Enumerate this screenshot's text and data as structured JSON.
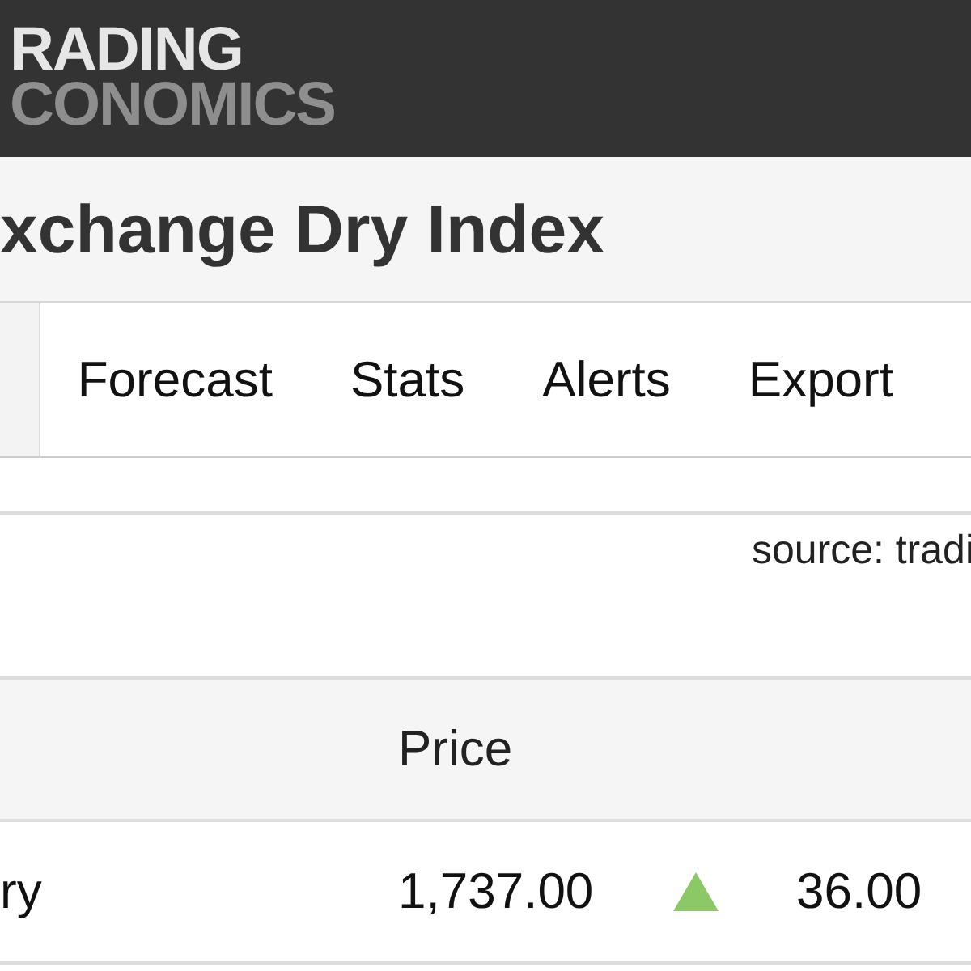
{
  "logo": {
    "line_1": "RADING",
    "line_2": "CONOMICS"
  },
  "title": "xchange Dry Index",
  "tabs": [
    {
      "label": "Forecast",
      "selected": false
    },
    {
      "label": "Stats",
      "selected": false
    },
    {
      "label": "Alerts",
      "selected": false
    },
    {
      "label": "Export",
      "selected": false
    }
  ],
  "source": "source: tradi",
  "table": {
    "columns": [
      "Price"
    ],
    "rows": [
      {
        "name": "ry",
        "price": "1,737.00",
        "rising": true,
        "change": "36.00"
      }
    ]
  }
}
